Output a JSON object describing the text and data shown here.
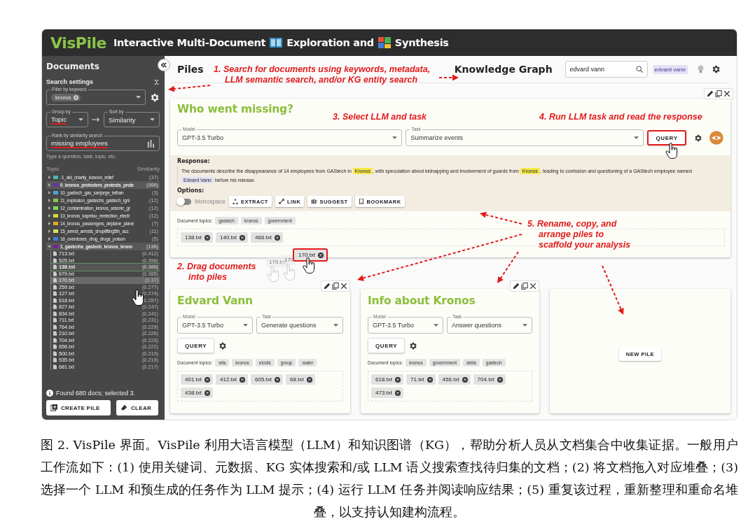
{
  "app": {
    "name": "VisPile",
    "title": [
      "Interactive Multi-Document",
      "Exploration and",
      "Synthesis"
    ]
  },
  "sidebar": {
    "heading": "Documents",
    "search_settings": "Search settings",
    "filter": {
      "label": "Filter by keyword",
      "chips": [
        "kronos"
      ]
    },
    "group_by": {
      "label": "Group by",
      "value": "Topic"
    },
    "sort_by": {
      "label": "Sort by",
      "value": "Similarity"
    },
    "rank": {
      "label": "Rank by similarity search",
      "value": "missing employees",
      "hint": "Type a question, task, topic, etc."
    },
    "tree": {
      "columns": [
        "Topic",
        "Similarity"
      ],
      "topics": [
        {
          "label": "-1_aid_charity_kosovo_relief",
          "count": "(37)",
          "color": "#4db6ac",
          "selected": false,
          "expanded": false
        },
        {
          "label": "0_kronos_protesters_protests_prote",
          "count": "(300)",
          "color": "#5e35b1",
          "selected": true,
          "expanded": false
        },
        {
          "label": "10_gastech_gas_sanjorge_tethan",
          "count": "(3)",
          "color": "#4fa3d8",
          "selected": false,
          "expanded": false
        },
        {
          "label": "11_explosion_gastechs_gastech_igni",
          "count": "(12)",
          "color": "#8bc34a",
          "selected": false,
          "expanded": false
        },
        {
          "label": "12_contamination_kronos_arsenic_gr",
          "count": "(12)",
          "color": "#7ed957",
          "selected": false,
          "expanded": false
        },
        {
          "label": "13_kronos_kapelou_reelection_electi",
          "count": "(12)",
          "color": "#cddc39",
          "selected": false,
          "expanded": false
        },
        {
          "label": "14_kronos_passengers_airplane_plane",
          "count": "(7)",
          "color": "#e0a82e",
          "selected": false,
          "expanded": false
        },
        {
          "label": "15_arrest_arrests_shoplifting5th_acc",
          "count": "(11)",
          "color": "#d4e157",
          "selected": false,
          "expanded": false
        },
        {
          "label": "16_overdoses_drug_drugs_poison",
          "count": "(5)",
          "color": "#3d7ee0",
          "selected": false,
          "expanded": false
        },
        {
          "label": "1_gastechs_gastech_kronos_krono",
          "count": "(136)",
          "color": "#7b1fa2",
          "selected": true,
          "expanded": true,
          "children": [
            {
              "name": "713.txt",
              "score": "(0.412)",
              "selected": false,
              "hovered": false
            },
            {
              "name": "525.txt",
              "score": "(0.398)",
              "selected": false,
              "hovered": false
            },
            {
              "name": "138.txt",
              "score": "(0.388)",
              "selected": true,
              "hovered": false
            },
            {
              "name": "679.txt",
              "score": "(0.385)",
              "selected": false,
              "hovered": false
            },
            {
              "name": "170.txt",
              "score": "(0.37)",
              "selected": false,
              "hovered": true
            },
            {
              "name": "259.txt",
              "score": "(0.277)",
              "selected": false,
              "hovered": false
            },
            {
              "name": "127.txt",
              "score": "(0.274)",
              "selected": false,
              "hovered": false
            },
            {
              "name": "618.txt",
              "score": "(0.257)",
              "selected": false,
              "hovered": false
            },
            {
              "name": "827.txt",
              "score": "(0.247)",
              "selected": false,
              "hovered": false
            },
            {
              "name": "834.txt",
              "score": "(0.241)",
              "selected": false,
              "hovered": false
            },
            {
              "name": "711.txt",
              "score": "(0.231)",
              "selected": false,
              "hovered": false
            },
            {
              "name": "764.txt",
              "score": "(0.229)",
              "selected": false,
              "hovered": false
            },
            {
              "name": "210.txt",
              "score": "(0.226)",
              "selected": false,
              "hovered": false
            },
            {
              "name": "704.txt",
              "score": "(0.223)",
              "selected": false,
              "hovered": false
            },
            {
              "name": "656.txt",
              "score": "(0.222)",
              "selected": false,
              "hovered": false
            },
            {
              "name": "500.txt",
              "score": "(0.219)",
              "selected": false,
              "hovered": false
            },
            {
              "name": "535.txt",
              "score": "(0.219)",
              "selected": false,
              "hovered": false
            },
            {
              "name": "681.txt",
              "score": "(0.217)",
              "selected": false,
              "hovered": false
            }
          ]
        }
      ]
    },
    "status": "Found 680 docs; selected 3.",
    "buttons": [
      {
        "label": "CREATE PILE",
        "kind": "create"
      },
      {
        "label": "CLEAR",
        "kind": "clear"
      }
    ]
  },
  "header": {
    "piles_title": "Piles",
    "kg_title": "Knowledge Graph",
    "search": {
      "value": "edvard vann"
    },
    "entity_chips": [
      "edvard vann"
    ]
  },
  "piles": [
    {
      "kind": "expanded",
      "title": "Who went missing?",
      "model": {
        "label": "Model",
        "value": "GPT-3.5 Turbo"
      },
      "task": {
        "label": "Task",
        "value": "Summarize events"
      },
      "query": "QUERY",
      "query_highlighted": true,
      "response": {
        "label": "Response:",
        "segments": [
          {
            "kind": "plain",
            "text": "The documents describe the disappearance of 14 employees from GAStech in "
          },
          {
            "kind": "entity",
            "text": "Kronos",
            "color": "#f5e94a"
          },
          {
            "kind": "plain",
            "text": ", with speculation about kidnapping and involvement of guards from "
          },
          {
            "kind": "entity",
            "text": "Kronos",
            "color": "#f5e94a"
          },
          {
            "kind": "plain",
            "text": ", leading to confusion and questioning of a GAStech employee named "
          },
          {
            "kind": "entity",
            "text": "Edvard Vann",
            "color": "#e3e0f5"
          },
          {
            "kind": "plain",
            "text": " before his release."
          }
        ]
      },
      "options": {
        "label": "Options:",
        "toggle": {
          "label": "Monospace",
          "on": false
        },
        "buttons": [
          {
            "label": "EXTRACT",
            "kind": "extract"
          },
          {
            "label": "LINK",
            "kind": "link"
          },
          {
            "label": "SUGGEST",
            "kind": "suggest"
          },
          {
            "label": "BOOKMARK",
            "kind": "bookmark"
          }
        ]
      },
      "topics_label": "Document topics:",
      "topics": [
        "gastech",
        "kronos",
        "government"
      ],
      "documents": [
        "138.txt",
        "140.txt",
        "466.txt"
      ]
    },
    {
      "kind": "compact",
      "title": "Edvard Vann",
      "model": {
        "label": "Model",
        "value": "GPT-3.5 Turbo"
      },
      "task": {
        "label": "Task",
        "value": "Generate questions"
      },
      "query": "QUERY",
      "query_highlighted": false,
      "topics_label": "Document topics:",
      "topics": [
        "wfa",
        "kronos",
        "elodis",
        "group",
        "water"
      ],
      "documents": [
        "401.txt",
        "412.txt",
        "605.txt",
        "68.txt",
        "438.txt"
      ]
    },
    {
      "kind": "compact",
      "title": "Info about Kronos",
      "model": {
        "label": "Model",
        "value": "GPT-3.5 Turbo"
      },
      "task": {
        "label": "Task",
        "value": "Answer questions"
      },
      "query": "QUERY",
      "query_highlighted": false,
      "topics_label": "Document topics:",
      "topics": [
        "kronos",
        "government",
        "abila",
        "gastech"
      ],
      "documents": [
        "618.txt",
        "71.txt",
        "456.txt",
        "704.txt",
        "473.txt"
      ]
    }
  ],
  "new_pile_button": "NEW PILE",
  "drag": {
    "chip": "170.txt",
    "ghosts": [
      "170.txt",
      "170"
    ]
  },
  "annotations": [
    {
      "lines": [
        "1. Search for documents using keywords, metadata,",
        "LLM semantic search, and/or KG entity search"
      ]
    },
    {
      "lines": [
        "3. Select LLM and task"
      ]
    },
    {
      "lines": [
        "4. Run LLM task and read the response"
      ]
    },
    {
      "lines": [
        "5. Rename, copy, and",
        "arrange piles to",
        "scaffold your analysis"
      ]
    },
    {
      "lines": [
        "2. Drag documents",
        "into piles"
      ]
    }
  ],
  "caption": "图 2.  VisPile 界面。VisPile 利用大语言模型（LLM）和知识图谱（KG），帮助分析人员从文档集合中收集证据。一般用户工作流如下：(1) 使用关键词、元数据、KG 实体搜索和/或 LLM 语义搜索查找待归集的文档；(2) 将文档拖入对应堆叠；(3) 选择一个 LLM 和预生成的任务作为 LLM 提示；(4) 运行 LLM 任务并阅读响应结果；(5) 重复该过程，重新整理和重命名堆叠，以支持认知建构流程。"
}
